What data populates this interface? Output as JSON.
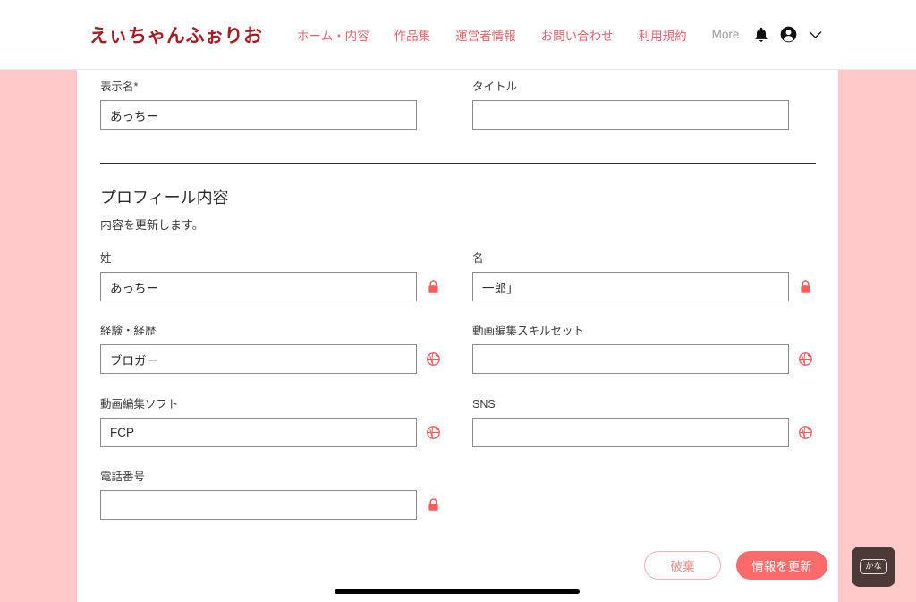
{
  "navbar": {
    "brand": "えぃちゃんふぉりお",
    "links": [
      {
        "label": "ホーム・内容",
        "style": "red"
      },
      {
        "label": "作品集",
        "style": "red"
      },
      {
        "label": "運営者情報",
        "style": "red"
      },
      {
        "label": "お問い合わせ",
        "style": "red"
      },
      {
        "label": "利用規約",
        "style": "red"
      },
      {
        "label": "More",
        "style": "gray"
      }
    ],
    "icons": [
      {
        "name": "notification-bell-icon"
      },
      {
        "name": "account-circle-icon"
      },
      {
        "name": "chevron-down-icon"
      }
    ]
  },
  "top_fields": [
    {
      "label": "表示名",
      "required": true,
      "required_mark": "*",
      "value": "あっちー",
      "placeholder": "",
      "icon": "none"
    },
    {
      "label": "タイトル",
      "required": false,
      "required_mark": "",
      "value": "",
      "placeholder": "",
      "icon": "none"
    }
  ],
  "section": {
    "title": "プロフィール内容",
    "subtitle": "内容を更新します。"
  },
  "profile_fields": [
    {
      "label": "姓",
      "value": "あっちー",
      "placeholder": "",
      "icon": "lock-icon"
    },
    {
      "label": "名",
      "value": "一郎」",
      "placeholder": "",
      "icon": "lock-icon"
    },
    {
      "label": "経験・経歴",
      "value": "ブロガー",
      "placeholder": "",
      "icon": "globe-icon"
    },
    {
      "label": "動画編集スキルセット",
      "value": "",
      "placeholder": "",
      "icon": "globe-icon"
    },
    {
      "label": "動画編集ソフト",
      "value": "FCP",
      "placeholder": "",
      "icon": "globe-icon"
    },
    {
      "label": "SNS",
      "value": "",
      "placeholder": "",
      "icon": "globe-icon"
    },
    {
      "label": "電話番号",
      "value": "",
      "placeholder": "",
      "icon": "lock-icon"
    }
  ],
  "actions": {
    "discard_label": "破棄",
    "submit_label": "情報を更新"
  },
  "ime_widget": {
    "label": "かな"
  },
  "colors": {
    "brand_red": "#a51c23",
    "nav_link_red": "#e2656a",
    "nav_link_gray": "#9a9a9a",
    "page_pink": "#ffc9c9",
    "accent_coral": "#fd6a6a",
    "ghost_border": "#ffb0b0",
    "input_border": "#8c8c8c",
    "ime_bg": "#4b3a38"
  }
}
